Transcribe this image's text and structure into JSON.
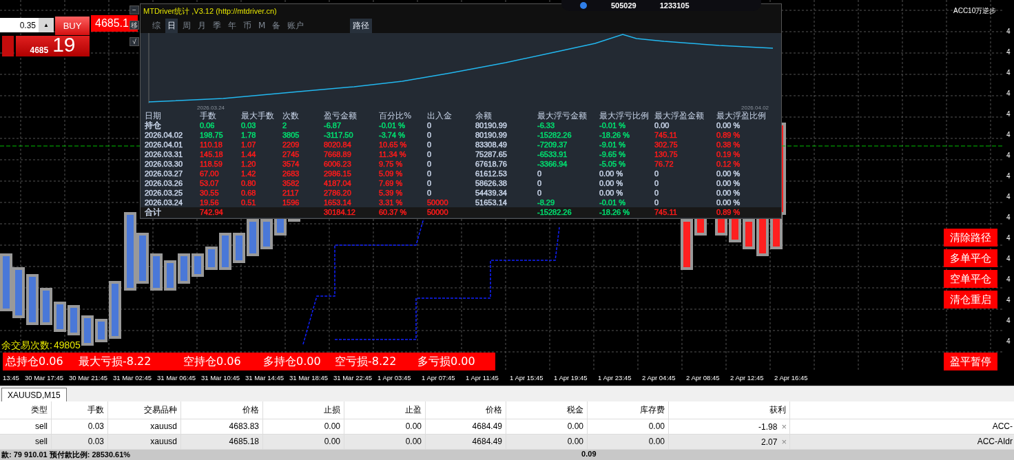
{
  "top_badge": {
    "values": [
      "505029",
      "1233105"
    ]
  },
  "corner_label": "ACC10万逆步",
  "trade_widget": {
    "lot": "0.35",
    "spin": "▲",
    "buy": "BUY",
    "price": "4685.1",
    "big_price": "4685",
    "big_digits": "19",
    "tools": [
      "−",
      "移",
      "√"
    ]
  },
  "stats_panel": {
    "title": "MTDriver统计 ,V3.12 (http://mtdriver.cn)",
    "tabs": [
      {
        "label": "综",
        "selected": false
      },
      {
        "label": "日",
        "selected": true
      },
      {
        "label": "周",
        "selected": false
      },
      {
        "label": "月",
        "selected": false
      },
      {
        "label": "季",
        "selected": false
      },
      {
        "label": "年",
        "selected": false
      },
      {
        "label": "币",
        "selected": false
      },
      {
        "label": "M",
        "selected": false
      },
      {
        "label": "备",
        "selected": false
      },
      {
        "label": "账户",
        "selected": false
      }
    ],
    "path_button": "路径",
    "chart_dates": [
      "2026.03.24",
      "2026.04.02"
    ],
    "columns": [
      "日期",
      "手数",
      "最大手数",
      "次数",
      "盈亏金额",
      "百分比%",
      "出入金",
      "余额",
      "最大浮亏金额",
      "最大浮亏比例",
      "最大浮盈金额",
      "最大浮盈比例"
    ],
    "rows": [
      {
        "kind": "holding",
        "cells": [
          {
            "text": "持仓",
            "color": "#c8d4e8"
          },
          {
            "text": "0.06",
            "color": "#00e070"
          },
          {
            "text": "0.03",
            "color": "#00e070"
          },
          {
            "text": "2",
            "color": "#00e070"
          },
          {
            "text": "-6.87",
            "color": "#00e070"
          },
          {
            "text": "-0.01 %",
            "color": "#00e070"
          },
          {
            "text": "0",
            "color": "#c8d4e8"
          },
          {
            "text": "80190.99",
            "color": "#c8d4e8"
          },
          {
            "text": "-6.33",
            "color": "#00e070"
          },
          {
            "text": "-0.01 %",
            "color": "#00e070"
          },
          {
            "text": "0.00",
            "color": "#c8d4e8"
          },
          {
            "text": "0.00 %",
            "color": "#c8d4e8"
          }
        ]
      },
      {
        "kind": "day",
        "cells": [
          {
            "text": "2026.04.02",
            "color": "#c8d4e8"
          },
          {
            "text": "198.75",
            "color": "#00e070"
          },
          {
            "text": "1.78",
            "color": "#00e070"
          },
          {
            "text": "3805",
            "color": "#00e070"
          },
          {
            "text": "-3117.50",
            "color": "#00e070"
          },
          {
            "text": "-3.74 %",
            "color": "#00e070"
          },
          {
            "text": "0",
            "color": "#c8d4e8"
          },
          {
            "text": "80190.99",
            "color": "#c8d4e8"
          },
          {
            "text": "-15282.26",
            "color": "#00e070"
          },
          {
            "text": "-18.26 %",
            "color": "#00e070"
          },
          {
            "text": "745.11",
            "color": "#ff1a1a"
          },
          {
            "text": "0.89 %",
            "color": "#ff1a1a"
          }
        ]
      },
      {
        "kind": "day",
        "cells": [
          {
            "text": "2026.04.01",
            "color": "#c8d4e8"
          },
          {
            "text": "110.18",
            "color": "#ff1a1a"
          },
          {
            "text": "1.07",
            "color": "#ff1a1a"
          },
          {
            "text": "2209",
            "color": "#ff1a1a"
          },
          {
            "text": "8020.84",
            "color": "#ff1a1a"
          },
          {
            "text": "10.65 %",
            "color": "#ff1a1a"
          },
          {
            "text": "0",
            "color": "#c8d4e8"
          },
          {
            "text": "83308.49",
            "color": "#c8d4e8"
          },
          {
            "text": "-7209.37",
            "color": "#00e070"
          },
          {
            "text": "-9.01 %",
            "color": "#00e070"
          },
          {
            "text": "302.75",
            "color": "#ff1a1a"
          },
          {
            "text": "0.38 %",
            "color": "#ff1a1a"
          }
        ]
      },
      {
        "kind": "day",
        "cells": [
          {
            "text": "2026.03.31",
            "color": "#c8d4e8"
          },
          {
            "text": "145.18",
            "color": "#ff1a1a"
          },
          {
            "text": "1.44",
            "color": "#ff1a1a"
          },
          {
            "text": "2745",
            "color": "#ff1a1a"
          },
          {
            "text": "7668.89",
            "color": "#ff1a1a"
          },
          {
            "text": "11.34 %",
            "color": "#ff1a1a"
          },
          {
            "text": "0",
            "color": "#c8d4e8"
          },
          {
            "text": "75287.65",
            "color": "#c8d4e8"
          },
          {
            "text": "-6533.91",
            "color": "#00e070"
          },
          {
            "text": "-9.65 %",
            "color": "#00e070"
          },
          {
            "text": "130.75",
            "color": "#ff1a1a"
          },
          {
            "text": "0.19 %",
            "color": "#ff1a1a"
          }
        ]
      },
      {
        "kind": "day",
        "cells": [
          {
            "text": "2026.03.30",
            "color": "#c8d4e8"
          },
          {
            "text": "118.59",
            "color": "#ff1a1a"
          },
          {
            "text": "1.20",
            "color": "#ff1a1a"
          },
          {
            "text": "3574",
            "color": "#ff1a1a"
          },
          {
            "text": "6006.23",
            "color": "#ff1a1a"
          },
          {
            "text": "9.75 %",
            "color": "#ff1a1a"
          },
          {
            "text": "0",
            "color": "#c8d4e8"
          },
          {
            "text": "67618.76",
            "color": "#c8d4e8"
          },
          {
            "text": "-3366.94",
            "color": "#00e070"
          },
          {
            "text": "-5.05 %",
            "color": "#00e070"
          },
          {
            "text": "76.72",
            "color": "#ff1a1a"
          },
          {
            "text": "0.12 %",
            "color": "#ff1a1a"
          }
        ]
      },
      {
        "kind": "day",
        "cells": [
          {
            "text": "2026.03.27",
            "color": "#c8d4e8"
          },
          {
            "text": "67.00",
            "color": "#ff1a1a"
          },
          {
            "text": "1.42",
            "color": "#ff1a1a"
          },
          {
            "text": "2683",
            "color": "#ff1a1a"
          },
          {
            "text": "2986.15",
            "color": "#ff1a1a"
          },
          {
            "text": "5.09 %",
            "color": "#ff1a1a"
          },
          {
            "text": "0",
            "color": "#c8d4e8"
          },
          {
            "text": "61612.53",
            "color": "#c8d4e8"
          },
          {
            "text": "0",
            "color": "#c8d4e8"
          },
          {
            "text": "0.00 %",
            "color": "#c8d4e8"
          },
          {
            "text": "0",
            "color": "#c8d4e8"
          },
          {
            "text": "0.00 %",
            "color": "#c8d4e8"
          }
        ]
      },
      {
        "kind": "day",
        "cells": [
          {
            "text": "2026.03.26",
            "color": "#c8d4e8"
          },
          {
            "text": "53.07",
            "color": "#ff1a1a"
          },
          {
            "text": "0.80",
            "color": "#ff1a1a"
          },
          {
            "text": "3582",
            "color": "#ff1a1a"
          },
          {
            "text": "4187.04",
            "color": "#ff1a1a"
          },
          {
            "text": "7.69 %",
            "color": "#ff1a1a"
          },
          {
            "text": "0",
            "color": "#c8d4e8"
          },
          {
            "text": "58626.38",
            "color": "#c8d4e8"
          },
          {
            "text": "0",
            "color": "#c8d4e8"
          },
          {
            "text": "0.00 %",
            "color": "#c8d4e8"
          },
          {
            "text": "0",
            "color": "#c8d4e8"
          },
          {
            "text": "0.00 %",
            "color": "#c8d4e8"
          }
        ]
      },
      {
        "kind": "day",
        "cells": [
          {
            "text": "2026.03.25",
            "color": "#c8d4e8"
          },
          {
            "text": "30.55",
            "color": "#ff1a1a"
          },
          {
            "text": "0.68",
            "color": "#ff1a1a"
          },
          {
            "text": "2117",
            "color": "#ff1a1a"
          },
          {
            "text": "2786.20",
            "color": "#ff1a1a"
          },
          {
            "text": "5.39 %",
            "color": "#ff1a1a"
          },
          {
            "text": "0",
            "color": "#c8d4e8"
          },
          {
            "text": "54439.34",
            "color": "#c8d4e8"
          },
          {
            "text": "0",
            "color": "#c8d4e8"
          },
          {
            "text": "0.00 %",
            "color": "#c8d4e8"
          },
          {
            "text": "0",
            "color": "#c8d4e8"
          },
          {
            "text": "0.00 %",
            "color": "#c8d4e8"
          }
        ]
      },
      {
        "kind": "day",
        "cells": [
          {
            "text": "2026.03.24",
            "color": "#c8d4e8"
          },
          {
            "text": "19.56",
            "color": "#ff1a1a"
          },
          {
            "text": "0.51",
            "color": "#ff1a1a"
          },
          {
            "text": "1596",
            "color": "#ff1a1a"
          },
          {
            "text": "1653.14",
            "color": "#ff1a1a"
          },
          {
            "text": "3.31 %",
            "color": "#ff1a1a"
          },
          {
            "text": "50000",
            "color": "#ff1a1a"
          },
          {
            "text": "51653.14",
            "color": "#c8d4e8"
          },
          {
            "text": "-8.29",
            "color": "#00e070"
          },
          {
            "text": "-0.01 %",
            "color": "#00e070"
          },
          {
            "text": "0",
            "color": "#c8d4e8"
          },
          {
            "text": "0.00 %",
            "color": "#c8d4e8"
          }
        ]
      },
      {
        "kind": "summary",
        "cells": [
          {
            "text": "合计",
            "color": "#c8d4e8"
          },
          {
            "text": "742.94",
            "color": "#ff1a1a"
          },
          null,
          null,
          {
            "text": "30184.12",
            "color": "#ff1a1a"
          },
          {
            "text": "60.37 %",
            "color": "#ff1a1a"
          },
          {
            "text": "50000",
            "color": "#ff1a1a"
          },
          null,
          {
            "text": "-15282.26",
            "color": "#00e070"
          },
          {
            "text": "-18.26 %",
            "color": "#00e070"
          },
          {
            "text": "745.11",
            "color": "#ff1a1a"
          },
          {
            "text": "0.89 %",
            "color": "#ff1a1a"
          }
        ]
      }
    ]
  },
  "remaining_trades": {
    "label": "余交易次数:",
    "value": "49805"
  },
  "summary_bar": [
    "总持仓0.06",
    "最大亏损-8.22",
    "空持仓0.06",
    "多持仓0.00",
    "空亏损-8.22",
    "多亏损0.00"
  ],
  "action_buttons": [
    "清除路径",
    "多单平仓",
    "空单平仓",
    "清仓重启"
  ],
  "pause_button": "盈平暂停",
  "price_axis": [
    "4",
    "4",
    "4",
    "4",
    "4",
    "4",
    "4",
    "4",
    "4",
    "4",
    "4",
    "4",
    "4",
    "4",
    "4",
    "4"
  ],
  "time_axis": [
    "13:45",
    "30 Mar 17:45",
    "30 Mar 21:45",
    "31 Mar 02:45",
    "31 Mar 06:45",
    "31 Mar 10:45",
    "31 Mar 14:45",
    "31 Mar 18:45",
    "31 Mar 22:45",
    "1 Apr 03:45",
    "1 Apr 07:45",
    "1 Apr 11:45",
    "1 Apr 15:45",
    "1 Apr 19:45",
    "1 Apr 23:45",
    "2 Apr 04:45",
    "2 Apr 08:45",
    "2 Apr 12:45",
    "2 Apr 16:45"
  ],
  "chart_tab": {
    "label": "XAUUSD,M15",
    "selected": true
  },
  "orders": {
    "columns": [
      "类型",
      "手数",
      "交易品种",
      "价格",
      "止损",
      "止盈",
      "价格",
      "税金",
      "库存费",
      "获利"
    ],
    "rows": [
      {
        "cells": [
          "sell",
          "0.03",
          "xauusd",
          "4683.83",
          "0.00",
          "0.00",
          "4684.49",
          "0.00",
          "0.00",
          "-1.98"
        ],
        "close": "×",
        "comment": "ACC-"
      },
      {
        "cells": [
          "sell",
          "0.03",
          "xauusd",
          "4685.18",
          "0.00",
          "0.00",
          "4684.49",
          "0.00",
          "0.00",
          "2.07"
        ],
        "close": "×",
        "comment": "ACC-AIdr"
      }
    ],
    "footer": "款: 79 910.01  预付款比例: 28530.61%",
    "footer_total": "0.09"
  }
}
